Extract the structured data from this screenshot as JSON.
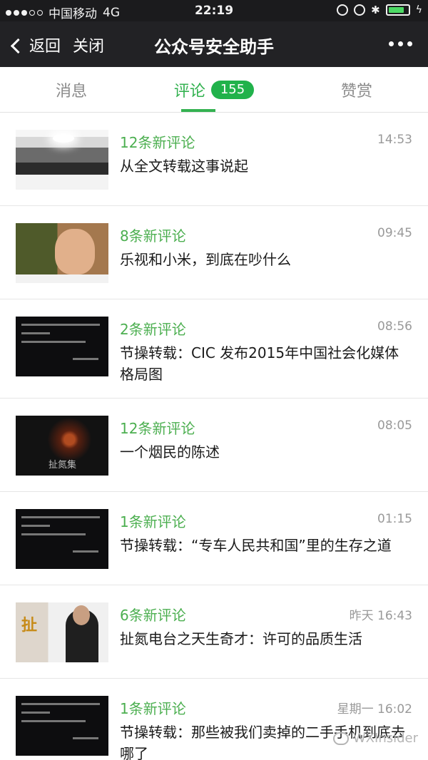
{
  "status_bar": {
    "carrier": "中国移动",
    "network": "4G",
    "time": "22:19"
  },
  "nav": {
    "back_label": "返回",
    "close_label": "关闭",
    "title": "公众号安全助手"
  },
  "tabs": [
    {
      "label": "消息"
    },
    {
      "label": "评论",
      "badge": "155"
    },
    {
      "label": "赞赏"
    }
  ],
  "accent_color": "#34b251",
  "items": [
    {
      "count": "12条新评论",
      "time": "14:53",
      "title": "从全文转载这事说起"
    },
    {
      "count": "8条新评论",
      "time": "09:45",
      "title": "乐视和小米，到底在吵什么"
    },
    {
      "count": "2条新评论",
      "time": "08:56",
      "title": "节操转载：CIC 发布2015年中国社会化媒体格局图"
    },
    {
      "count": "12条新评论",
      "time": "08:05",
      "title": "一个烟民的陈述",
      "thumb_text": "扯氮集"
    },
    {
      "count": "1条新评论",
      "time": "01:15",
      "title": "节操转载：“专车人民共和国”里的生存之道"
    },
    {
      "count": "6条新评论",
      "time": "昨天 16:43",
      "title": "扯氮电台之天生奇才：许可的品质生活"
    },
    {
      "count": "1条新评论",
      "time": "星期一 16:02",
      "title": "节操转载：那些被我们卖掉的二手手机到底去哪了"
    }
  ],
  "watermark": "WXInsider"
}
